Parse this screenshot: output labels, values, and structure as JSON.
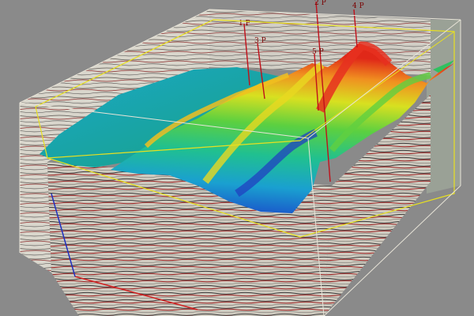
{
  "viewer": {
    "background_color": "#8a8a8a",
    "accent_colors": {
      "well_path": "#c0101a",
      "bounding_box_outline": "#e8e4d8",
      "survey_outline": "#e8e020",
      "axis_x": "#d02020",
      "axis_y": "#2030c0"
    },
    "horizon_colormap": [
      "#1a3cc8",
      "#1aa0d0",
      "#20c090",
      "#5cd040",
      "#d8e020",
      "#f09020",
      "#e02818"
    ],
    "wells": [
      {
        "label": "1 P"
      },
      {
        "label": "3 P"
      },
      {
        "label": "5 P"
      },
      {
        "label": "2 P"
      },
      {
        "label": "4 P"
      }
    ]
  }
}
